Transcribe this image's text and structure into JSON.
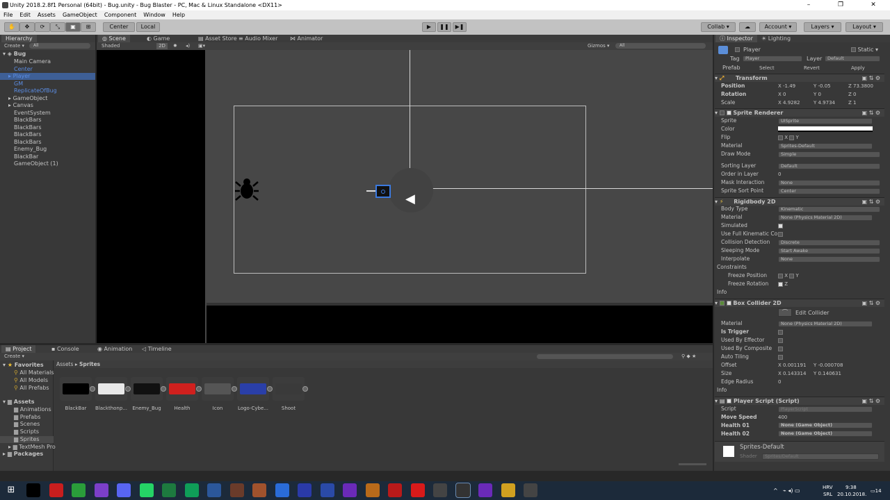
{
  "window": {
    "title": "Unity 2018.2.8f1 Personal (64bit) - Bug.unity - Bug Blaster - PC, Mac & Linux Standalone <DX11>",
    "minimize": "–",
    "maximize": "❐",
    "close": "✕"
  },
  "menu": [
    "File",
    "Edit",
    "Assets",
    "GameObject",
    "Component",
    "Window",
    "Help"
  ],
  "toolbar": {
    "tools": [
      "✋",
      "✥",
      "⟳",
      "⤡",
      "▣",
      "⊞"
    ],
    "center": "Center",
    "local": "Local",
    "collab": "Collab ▾",
    "cloud": "☁",
    "account": "Account ▾",
    "layers": "Layers ▾",
    "layout": "Layout ▾",
    "play": "▶",
    "pause": "❚❚",
    "step": "▶❚"
  },
  "hierarchy": {
    "tab": "Hierarchy",
    "create": "Create ▾",
    "search": "All",
    "scene": "Bug",
    "items": [
      {
        "label": "Main Camera",
        "blue": false,
        "arrow": false
      },
      {
        "label": "Center",
        "blue": true,
        "arrow": false
      },
      {
        "label": "Player",
        "blue": true,
        "arrow": true
      },
      {
        "label": "GM",
        "blue": true,
        "arrow": false
      },
      {
        "label": "ReplicateOfBug",
        "blue": true,
        "arrow": false
      },
      {
        "label": "GameObject",
        "blue": false,
        "arrow": true
      },
      {
        "label": "Canvas",
        "blue": false,
        "arrow": true
      },
      {
        "label": "EventSystem",
        "blue": false,
        "arrow": false
      },
      {
        "label": "BlackBars",
        "blue": false,
        "arrow": false
      },
      {
        "label": "BlackBars",
        "blue": false,
        "arrow": false
      },
      {
        "label": "BlackBars",
        "blue": false,
        "arrow": false
      },
      {
        "label": "BlackBars",
        "blue": false,
        "arrow": false
      },
      {
        "label": "Enemy_Bug",
        "blue": false,
        "arrow": false
      },
      {
        "label": "BlackBar",
        "blue": false,
        "arrow": false
      },
      {
        "label": "GameObject (1)",
        "blue": false,
        "arrow": false
      }
    ]
  },
  "scene": {
    "tabs": [
      "Scene",
      "Game",
      "Asset Store",
      "Audio Mixer",
      "Animator"
    ],
    "shaded": "Shaded",
    "mode2d": "2D",
    "gizmos": "Gizmos ▾",
    "search": "All"
  },
  "project": {
    "tabs": [
      "Project",
      "Console",
      "Animation",
      "Timeline"
    ],
    "create": "Create ▾",
    "favorites": "Favorites",
    "fav_items": [
      "All Materials",
      "All Models",
      "All Prefabs"
    ],
    "assets_label": "Assets",
    "asset_folders": [
      "Animations",
      "Prefabs",
      "Scenes",
      "Scripts",
      "Sprites",
      "TextMesh Pro"
    ],
    "packages": "Packages",
    "breadcrumb_root": "Assets",
    "breadcrumb_sep": "▸",
    "breadcrumb_leaf": "Sprites",
    "sprites": [
      {
        "name": "BlackBar",
        "color": "#000000"
      },
      {
        "name": "Blackthonp...",
        "color": "#e8e8e8"
      },
      {
        "name": "Enemy_Bug",
        "color": "#111111"
      },
      {
        "name": "Health",
        "color": "#d0201e"
      },
      {
        "name": "Icon",
        "color": "#555555"
      },
      {
        "name": "Logo-Cybe...",
        "color": "#2a3fa8"
      },
      {
        "name": "Shoot",
        "color": "#3a3a3a"
      }
    ]
  },
  "inspector": {
    "tabs": [
      "Inspector",
      "Lighting"
    ],
    "name": "Player",
    "static": "Static ▾",
    "tag_label": "Tag",
    "tag": "Player",
    "layer_label": "Layer",
    "layer": "Default",
    "prefab": "Prefab",
    "select": "Select",
    "revert": "Revert",
    "apply": "Apply",
    "transform": {
      "title": "Transform",
      "position": "Position",
      "rotation": "Rotation",
      "scale": "Scale",
      "pos": [
        "X -1.49",
        "Y -0.05",
        "Z 73.3800"
      ],
      "rot": [
        "X 0",
        "Y 0",
        "Z 0"
      ],
      "scl": [
        "X 4.9282",
        "Y 4.9734",
        "Z 1"
      ]
    },
    "sprite_renderer": {
      "title": "Sprite Renderer",
      "rows": [
        "Sprite",
        "Color",
        "Flip",
        "Material",
        "Draw Mode",
        "Sorting Layer",
        "Order in Layer",
        "Mask Interaction",
        "Sprite Sort Point"
      ],
      "sprite": "UISprite",
      "flip_x": "X",
      "flip_y": "Y",
      "material": "Sprites-Default",
      "draw_mode": "Simple",
      "sorting_layer": "Default",
      "order": "0",
      "mask": "None",
      "sort_point": "Center"
    },
    "rigidbody": {
      "title": "Rigidbody 2D",
      "rows": [
        "Body Type",
        "Material",
        "Simulated",
        "Use Full Kinematic Co",
        "Collision Detection",
        "Sleeping Mode",
        "Interpolate",
        "Constraints",
        "Freeze Position",
        "Freeze Rotation",
        "Info"
      ],
      "body_type": "Kinematic",
      "material": "None (Physics Material 2D)",
      "collision": "Discrete",
      "sleeping": "Start Awake",
      "interpolate": "None",
      "fx": "X",
      "fy": "Y",
      "rz": "Z"
    },
    "box_collider": {
      "title": "Box Collider 2D",
      "edit": "Edit Collider",
      "rows": [
        "Material",
        "Is Trigger",
        "Used By Effector",
        "Used By Composite",
        "Auto Tiling",
        "Offset",
        "Size",
        "Edge Radius",
        "Info"
      ],
      "material": "None (Physics Material 2D)",
      "offset_x": "X 0.001191",
      "offset_y": "Y -0.000708",
      "size_x": "X 0.143314",
      "size_y": "Y 0.140631",
      "edge": "0"
    },
    "script": {
      "title": "Player Script (Script)",
      "rows": [
        "Script",
        "Move Speed",
        "Health 01",
        "Health 02"
      ],
      "script": "PlayerScript",
      "speed": "400",
      "h1": "None (Game Object)",
      "h2": "None (Game Object)"
    },
    "material": {
      "name": "Sprites-Default",
      "shader_label": "Shader",
      "shader": "Sprites/Default"
    }
  },
  "taskbar": {
    "lang": "HRV",
    "lang2": "SRL",
    "time": "9:38",
    "date": "20.10.2018.",
    "notif": "14",
    "chevron": "^"
  },
  "icons": [
    "windows-icon",
    "search-icon",
    "opera-icon",
    "chrome-icon",
    "viber-icon",
    "discord-icon",
    "whatsapp-icon",
    "excel-icon",
    "sheets-icon",
    "word-icon",
    "wot-icon",
    "hearthstone-icon",
    "media-player-icon",
    "photoshop-icon",
    "audition-icon",
    "after-effects-icon",
    "premiere-icon",
    "illustrator-icon",
    "acrobat-icon",
    "youtube-icon",
    "unity-icon",
    "unity-hub-icon",
    "visual-studio-icon",
    "folder-icon"
  ],
  "colors": {
    "selection": "#3e5f96",
    "blue_text": "#5b8de4",
    "taskbar": "#1c2a3a"
  }
}
